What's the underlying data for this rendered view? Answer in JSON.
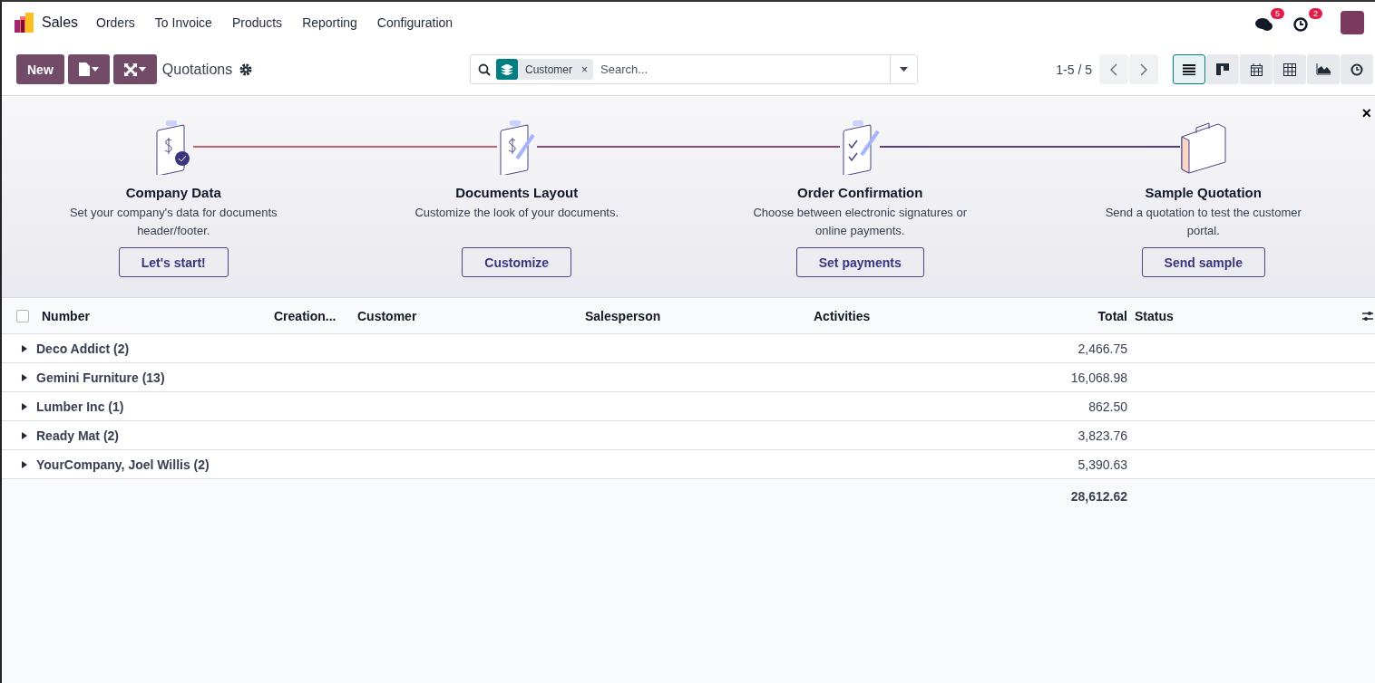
{
  "navbar": {
    "app": "Sales",
    "menu": [
      "Orders",
      "To Invoice",
      "Products",
      "Reporting",
      "Configuration"
    ],
    "messages_count": "5",
    "activities_count": "2"
  },
  "control_panel": {
    "new_label": "New",
    "title": "Quotations",
    "facet": "Customer",
    "facet_remove": "×",
    "placeholder": "Search...",
    "pager": "1-5 / 5",
    "views": [
      {
        "kind": "list",
        "selected": true
      },
      {
        "kind": "kanban",
        "selected": false
      },
      {
        "kind": "calendar",
        "selected": false
      },
      {
        "kind": "pivot",
        "selected": false
      },
      {
        "kind": "graph",
        "selected": false
      },
      {
        "kind": "activity",
        "selected": false
      }
    ]
  },
  "onboarding": {
    "close": "×",
    "steps": [
      {
        "kind": "company",
        "title": "Company Data",
        "text": "Set your company's data for documents header/footer.",
        "button": "Let's start!"
      },
      {
        "kind": "layout",
        "title": "Documents Layout",
        "text": "Customize the look of your documents.",
        "button": "Customize"
      },
      {
        "kind": "confirmation",
        "title": "Order Confirmation",
        "text": "Choose between electronic signatures or online payments.",
        "button": "Set payments"
      },
      {
        "kind": "sample",
        "title": "Sample Quotation",
        "text": "Send a quotation to test the customer portal.",
        "button": "Send sample"
      }
    ]
  },
  "table": {
    "select_all_checked": false,
    "columns": [
      "Number",
      "Creation...",
      "Customer",
      "Salesperson",
      "Activities",
      "Total",
      "Status"
    ],
    "groups": [
      {
        "name": "Deco Addict (2)",
        "total": "2,466.75",
        "expanded": false
      },
      {
        "name": "Gemini Furniture (13)",
        "total": "16,068.98",
        "expanded": false
      },
      {
        "name": "Lumber Inc (1)",
        "total": "862.50",
        "expanded": false
      },
      {
        "name": "Ready Mat (2)",
        "total": "3,823.76",
        "expanded": false
      },
      {
        "name": "YourCompany, Joel Willis (2)",
        "total": "5,390.63",
        "expanded": false
      }
    ],
    "grand_total": "28,612.62"
  }
}
